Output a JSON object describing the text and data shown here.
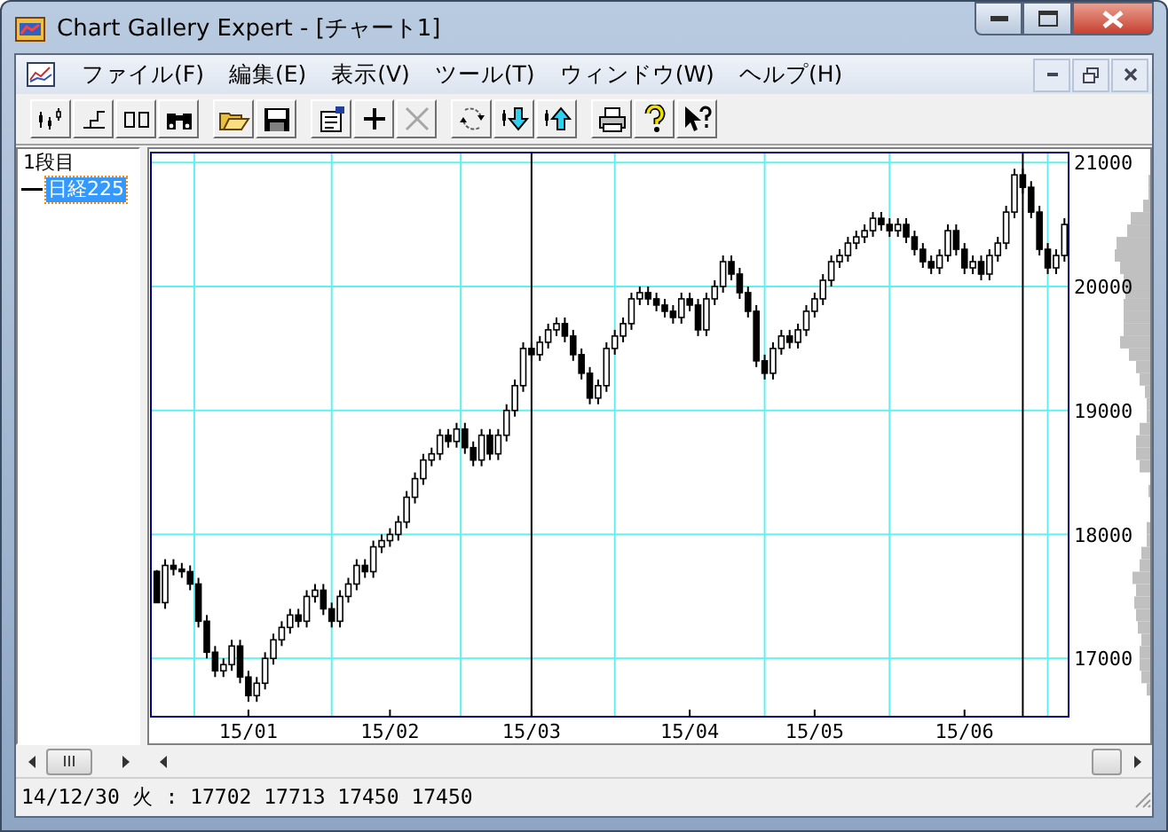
{
  "window": {
    "title": "Chart Gallery Expert - [チャート1]"
  },
  "menu": [
    {
      "label": "ファイル(F)"
    },
    {
      "label": "編集(E)"
    },
    {
      "label": "表示(V)"
    },
    {
      "label": "ツール(T)"
    },
    {
      "label": "ウィンドウ(W)"
    },
    {
      "label": "ヘルプ(H)"
    }
  ],
  "toolbar_groups": [
    [
      {
        "disabled": false
      },
      {
        "disabled": false
      },
      {
        "disabled": false
      },
      {
        "disabled": false
      }
    ],
    [
      {
        "disabled": false
      },
      {
        "disabled": false
      }
    ],
    [
      {
        "disabled": false
      },
      {
        "disabled": false
      },
      {
        "disabled": true
      }
    ],
    [
      {
        "disabled": false
      },
      {
        "disabled": false
      },
      {
        "disabled": false
      }
    ],
    [
      {
        "disabled": false
      },
      {
        "disabled": false
      },
      {
        "disabled": false
      }
    ]
  ],
  "tree": [
    {
      "label": "1段目",
      "selected": false,
      "children": [
        {
          "label": "日経225",
          "selected": true
        }
      ]
    }
  ],
  "chart": {
    "chart_data": {
      "type": "candlestick",
      "grid": true,
      "ylim": [
        16530,
        21080
      ],
      "yticks": [
        21000,
        20000,
        19000,
        18000,
        17000
      ],
      "categories": [
        null,
        null,
        null,
        null,
        null,
        null,
        null,
        null,
        null,
        null,
        null,
        "15/01",
        null,
        null,
        null,
        null,
        null,
        null,
        null,
        null,
        null,
        null,
        null,
        null,
        null,
        null,
        null,
        null,
        "15/02",
        null,
        null,
        null,
        null,
        null,
        null,
        null,
        null,
        null,
        null,
        null,
        null,
        null,
        null,
        null,
        null,
        "15/03",
        null,
        null,
        null,
        null,
        null,
        null,
        null,
        null,
        null,
        null,
        null,
        null,
        null,
        null,
        null,
        null,
        null,
        null,
        "15/04",
        null,
        null,
        null,
        null,
        null,
        null,
        null,
        null,
        null,
        null,
        null,
        null,
        null,
        null,
        "15/05",
        null,
        null,
        null,
        null,
        null,
        null,
        null,
        null,
        null,
        null,
        null,
        null,
        null,
        null,
        null,
        null,
        null,
        "15/06",
        null,
        null,
        null,
        null,
        null,
        null,
        null,
        null,
        null,
        null,
        null,
        null
      ],
      "ohlc": [
        [
          17702,
          17713,
          17450,
          17450
        ],
        [
          17450,
          17800,
          17400,
          17750
        ],
        [
          17750,
          17800,
          17670,
          17720
        ],
        [
          17720,
          17770,
          17650,
          17700
        ],
        [
          17700,
          17750,
          17550,
          17600
        ],
        [
          17600,
          17650,
          17250,
          17300
        ],
        [
          17300,
          17350,
          17000,
          17050
        ],
        [
          17050,
          17100,
          16850,
          16900
        ],
        [
          16900,
          17000,
          16850,
          16950
        ],
        [
          16950,
          17150,
          16900,
          17100
        ],
        [
          17100,
          17150,
          16800,
          16850
        ],
        [
          16850,
          16900,
          16650,
          16700
        ],
        [
          16700,
          16850,
          16650,
          16800
        ],
        [
          16800,
          17050,
          16750,
          17000
        ],
        [
          17000,
          17200,
          16950,
          17150
        ],
        [
          17150,
          17300,
          17100,
          17250
        ],
        [
          17250,
          17400,
          17200,
          17350
        ],
        [
          17350,
          17400,
          17250,
          17300
        ],
        [
          17300,
          17550,
          17250,
          17500
        ],
        [
          17500,
          17600,
          17450,
          17550
        ],
        [
          17550,
          17600,
          17350,
          17400
        ],
        [
          17400,
          17450,
          17250,
          17300
        ],
        [
          17300,
          17550,
          17250,
          17500
        ],
        [
          17500,
          17650,
          17450,
          17600
        ],
        [
          17600,
          17800,
          17550,
          17750
        ],
        [
          17750,
          17800,
          17650,
          17700
        ],
        [
          17700,
          17950,
          17650,
          17900
        ],
        [
          17900,
          18000,
          17850,
          17950
        ],
        [
          17950,
          18050,
          17900,
          18000
        ],
        [
          18000,
          18150,
          17950,
          18100
        ],
        [
          18100,
          18350,
          18050,
          18300
        ],
        [
          18300,
          18500,
          18250,
          18450
        ],
        [
          18450,
          18650,
          18400,
          18600
        ],
        [
          18600,
          18700,
          18550,
          18650
        ],
        [
          18650,
          18850,
          18600,
          18800
        ],
        [
          18800,
          18850,
          18700,
          18750
        ],
        [
          18750,
          18900,
          18700,
          18850
        ],
        [
          18850,
          18900,
          18650,
          18700
        ],
        [
          18700,
          18750,
          18550,
          18600
        ],
        [
          18600,
          18850,
          18550,
          18800
        ],
        [
          18800,
          18850,
          18600,
          18650
        ],
        [
          18650,
          18850,
          18600,
          18800
        ],
        [
          18800,
          19050,
          18750,
          19000
        ],
        [
          19000,
          19250,
          18950,
          19200
        ],
        [
          19200,
          19550,
          19150,
          19500
        ],
        [
          19500,
          19550,
          19400,
          19450
        ],
        [
          19450,
          19600,
          19400,
          19550
        ],
        [
          19550,
          19700,
          19500,
          19650
        ],
        [
          19650,
          19750,
          19600,
          19700
        ],
        [
          19700,
          19750,
          19550,
          19600
        ],
        [
          19600,
          19650,
          19400,
          19450
        ],
        [
          19450,
          19500,
          19250,
          19300
        ],
        [
          19300,
          19350,
          19050,
          19100
        ],
        [
          19100,
          19250,
          19050,
          19200
        ],
        [
          19200,
          19550,
          19150,
          19500
        ],
        [
          19500,
          19650,
          19450,
          19600
        ],
        [
          19600,
          19750,
          19550,
          19700
        ],
        [
          19700,
          19950,
          19650,
          19900
        ],
        [
          19900,
          20000,
          19850,
          19950
        ],
        [
          19950,
          20000,
          19850,
          19900
        ],
        [
          19900,
          19950,
          19800,
          19850
        ],
        [
          19850,
          19900,
          19750,
          19800
        ],
        [
          19800,
          19850,
          19700,
          19750
        ],
        [
          19750,
          19950,
          19700,
          19900
        ],
        [
          19900,
          19950,
          19800,
          19850
        ],
        [
          19850,
          19900,
          19600,
          19650
        ],
        [
          19650,
          19950,
          19600,
          19900
        ],
        [
          19900,
          20050,
          19850,
          20000
        ],
        [
          20000,
          20250,
          19950,
          20200
        ],
        [
          20200,
          20250,
          20050,
          20100
        ],
        [
          20100,
          20150,
          19900,
          19950
        ],
        [
          19950,
          20000,
          19750,
          19800
        ],
        [
          19800,
          19850,
          19350,
          19400
        ],
        [
          19400,
          19450,
          19250,
          19300
        ],
        [
          19300,
          19550,
          19250,
          19500
        ],
        [
          19500,
          19650,
          19450,
          19600
        ],
        [
          19600,
          19650,
          19500,
          19550
        ],
        [
          19550,
          19700,
          19500,
          19650
        ],
        [
          19650,
          19850,
          19600,
          19800
        ],
        [
          19800,
          19950,
          19750,
          19900
        ],
        [
          19900,
          20100,
          19850,
          20050
        ],
        [
          20050,
          20250,
          20000,
          20200
        ],
        [
          20200,
          20300,
          20150,
          20250
        ],
        [
          20250,
          20400,
          20200,
          20350
        ],
        [
          20350,
          20450,
          20300,
          20400
        ],
        [
          20400,
          20500,
          20350,
          20450
        ],
        [
          20450,
          20600,
          20400,
          20550
        ],
        [
          20550,
          20600,
          20450,
          20500
        ],
        [
          20500,
          20550,
          20400,
          20450
        ],
        [
          20450,
          20550,
          20400,
          20500
        ],
        [
          20500,
          20550,
          20350,
          20400
        ],
        [
          20400,
          20450,
          20250,
          20300
        ],
        [
          20300,
          20350,
          20150,
          20200
        ],
        [
          20200,
          20250,
          20100,
          20150
        ],
        [
          20150,
          20300,
          20100,
          20250
        ],
        [
          20250,
          20500,
          20200,
          20450
        ],
        [
          20450,
          20500,
          20250,
          20300
        ],
        [
          20300,
          20350,
          20100,
          20150
        ],
        [
          20150,
          20250,
          20100,
          20200
        ],
        [
          20200,
          20250,
          20050,
          20100
        ],
        [
          20100,
          20300,
          20050,
          20250
        ],
        [
          20250,
          20400,
          20200,
          20350
        ],
        [
          20350,
          20650,
          20300,
          20600
        ],
        [
          20600,
          20950,
          20550,
          20900
        ],
        [
          20900,
          20950,
          20750,
          20800
        ],
        [
          20800,
          20850,
          20550,
          20600
        ],
        [
          20600,
          20650,
          20250,
          20300
        ],
        [
          20300,
          20350,
          20100,
          20150
        ],
        [
          20150,
          20300,
          20100,
          20250
        ],
        [
          20250,
          20550,
          20200,
          20500
        ]
      ]
    }
  },
  "status_bar": "14/12/30 火 : 17702 17713 17450 17450"
}
